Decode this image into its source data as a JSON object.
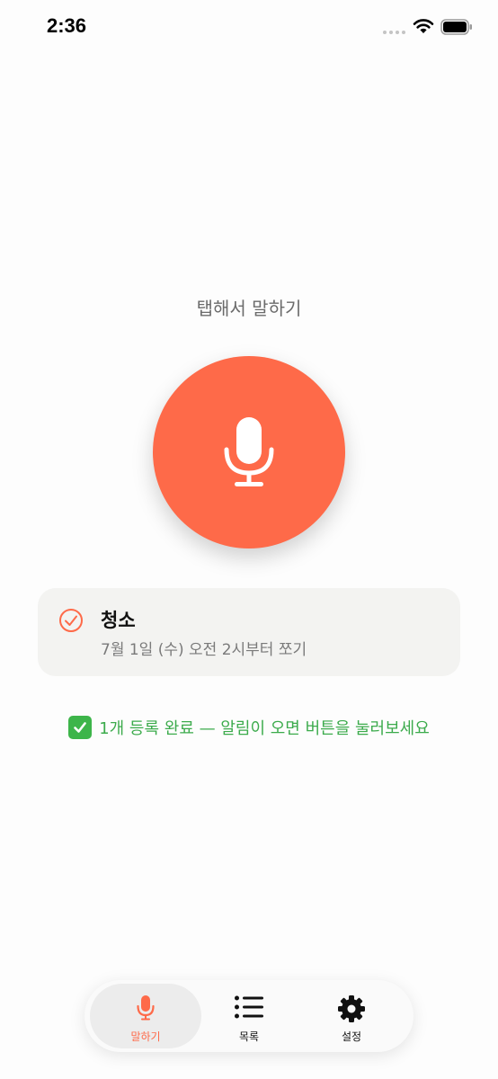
{
  "status_bar": {
    "time": "2:36",
    "icons": [
      "signal-icon",
      "wifi-icon",
      "battery-icon"
    ]
  },
  "main": {
    "prompt": "탭해서 말하기",
    "mic_icon": "microphone-icon",
    "accent_color": "#fe6a49"
  },
  "reminder": {
    "title": "청소",
    "subtitle": "7월 1일 (수) 오전 2시부터 쪼기",
    "icon": "check-circle-icon"
  },
  "status_message": {
    "emoji": "✅",
    "text": "1개 등록 완료 — 알림이 오면 버튼을 눌러보세요",
    "color": "#3cab4c"
  },
  "tab_bar": {
    "tabs": [
      {
        "label": "말하기",
        "icon": "microphone-icon",
        "active": true
      },
      {
        "label": "목록",
        "icon": "list-icon",
        "active": false
      },
      {
        "label": "설정",
        "icon": "gear-icon",
        "active": false
      }
    ]
  }
}
